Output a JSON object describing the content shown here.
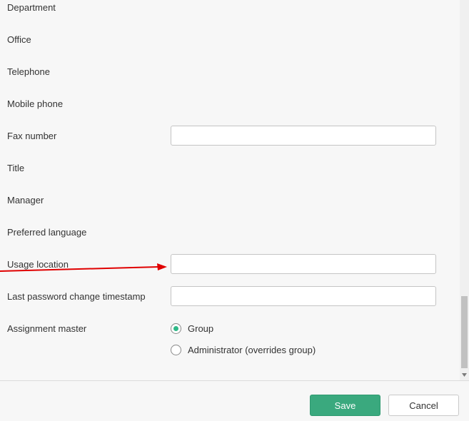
{
  "form": {
    "department_label": "Department",
    "office_label": "Office",
    "telephone_label": "Telephone",
    "mobile_phone_label": "Mobile phone",
    "fax_number_label": "Fax number",
    "fax_number_value": "",
    "title_label": "Title",
    "manager_label": "Manager",
    "preferred_language_label": "Preferred language",
    "usage_location_label": "Usage location",
    "usage_location_value": "",
    "last_password_change_label": "Last password change timestamp",
    "last_password_change_value": "",
    "assignment_master_label": "Assignment master",
    "assignment_master_options": [
      {
        "label": "Group",
        "selected": true
      },
      {
        "label": "Administrator (overrides group)",
        "selected": false
      }
    ]
  },
  "footer": {
    "save_label": "Save",
    "cancel_label": "Cancel"
  },
  "colors": {
    "accent": "#3aa97e",
    "annotation_arrow": "#e00000"
  },
  "icons": {
    "scroll_down": "chevron-down-icon",
    "annotation": "red-arrow-icon"
  }
}
